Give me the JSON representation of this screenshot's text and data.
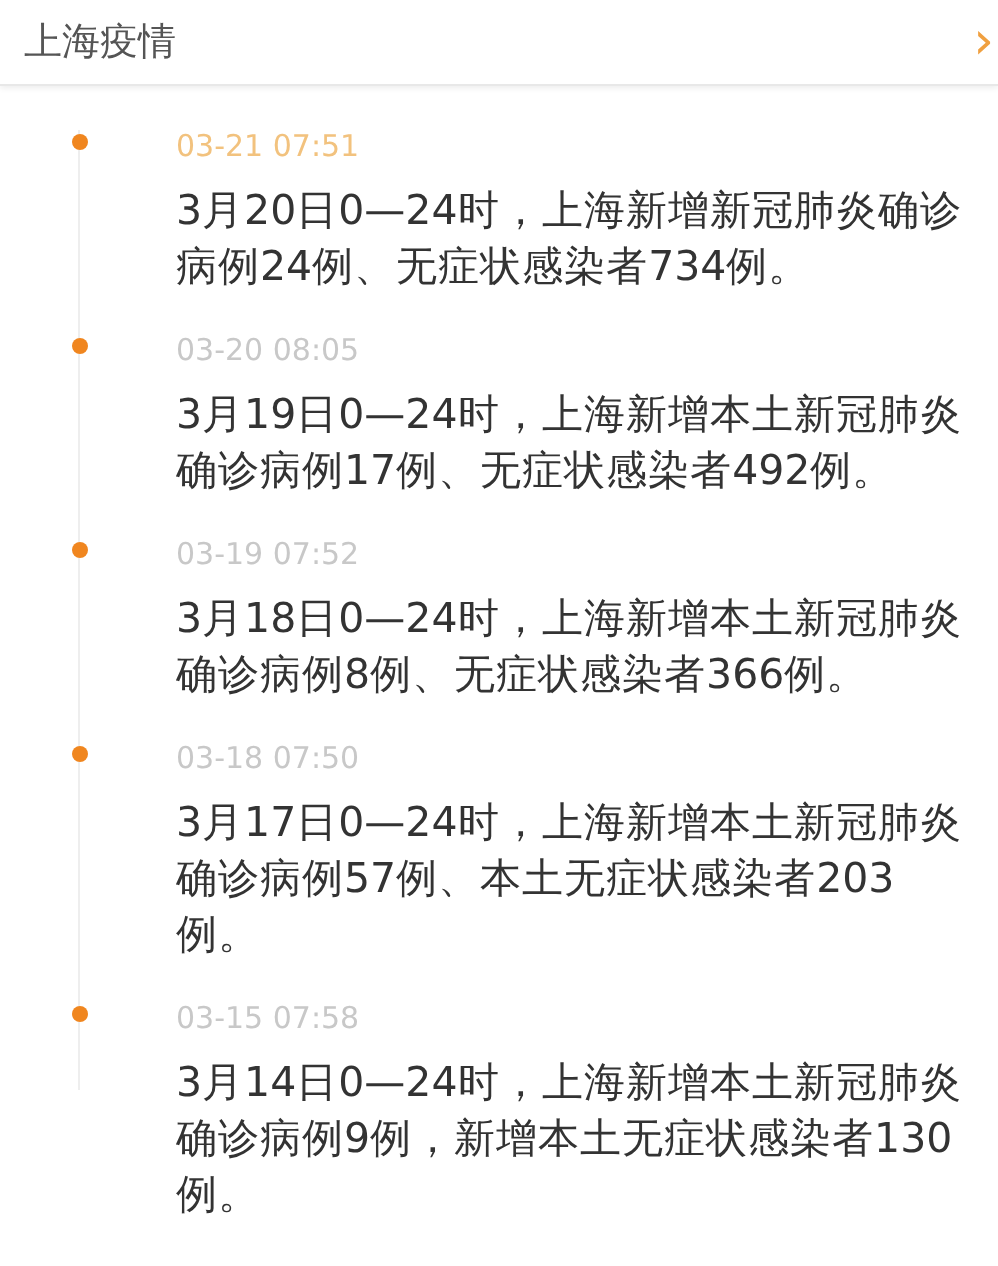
{
  "header": {
    "title": "上海疫情",
    "chevron": "›"
  },
  "timeline": [
    {
      "time": "03-21 07:51",
      "highlighted": true,
      "text": "3月20日0—24时，上海新增新冠肺炎确诊病例24例、无症状感染者734例。"
    },
    {
      "time": "03-20 08:05",
      "highlighted": false,
      "text": "3月19日0—24时，上海新增本土新冠肺炎确诊病例17例、无症状感染者492例。"
    },
    {
      "time": "03-19 07:52",
      "highlighted": false,
      "text": "3月18日0—24时，上海新增本土新冠肺炎确诊病例8例、无症状感染者366例。"
    },
    {
      "time": "03-18 07:50",
      "highlighted": false,
      "text": "3月17日0—24时，上海新增本土新冠肺炎确诊病例57例、本土无症状感染者203例。"
    },
    {
      "time": "03-15 07:58",
      "highlighted": false,
      "text": "3月14日0—24时，上海新增本土新冠肺炎确诊病例9例，新增本土无症状感染者130例。"
    }
  ]
}
